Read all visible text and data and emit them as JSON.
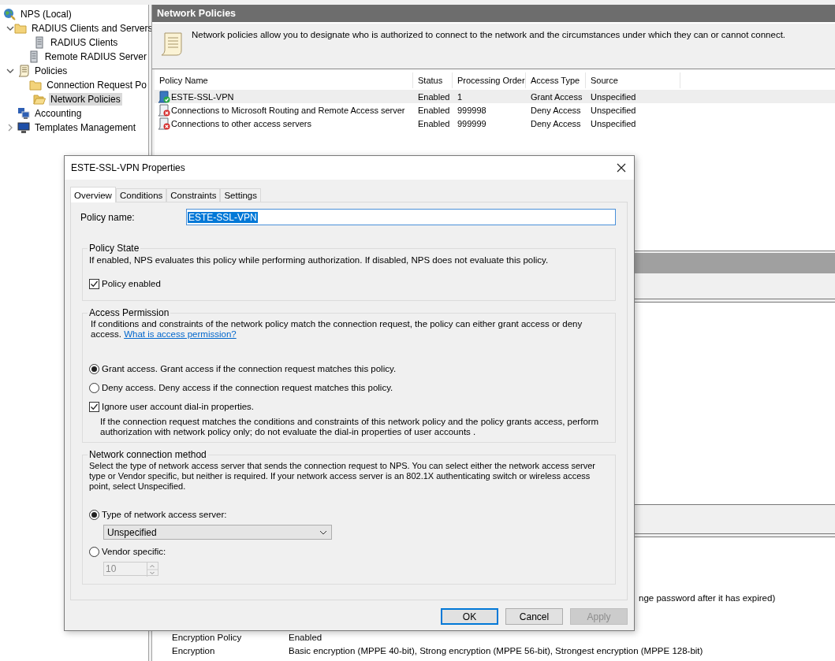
{
  "tree": [
    {
      "label": "NPS (Local)",
      "kind": "globe",
      "selected": false,
      "children": [
        {
          "label": "RADIUS Clients and Servers",
          "kind": "folder",
          "expanded": true,
          "selected": false,
          "children": [
            {
              "label": "RADIUS Clients",
              "kind": "server",
              "selected": false
            },
            {
              "label": "Remote RADIUS Server",
              "kind": "server",
              "selected": false
            }
          ]
        },
        {
          "label": "Policies",
          "kind": "scroll",
          "expanded": true,
          "selected": false,
          "children": [
            {
              "label": "Connection Request Po",
              "kind": "folder",
              "selected": false
            },
            {
              "label": "Network Policies",
              "kind": "folder-open",
              "selected": true
            }
          ]
        },
        {
          "label": "Accounting",
          "kind": "computers",
          "selected": false
        },
        {
          "label": "Templates Management",
          "kind": "monitor",
          "expanded": false,
          "selected": false
        }
      ]
    }
  ],
  "pane_title": "Network Policies",
  "pane_description": "Network policies allow you to designate who is authorized to connect to the network and the circumstances under which they can or cannot connect.",
  "policies": {
    "columns": [
      "Policy Name",
      "Status",
      "Processing Order",
      "Access Type",
      "Source"
    ],
    "rows": [
      {
        "kind": "grant",
        "selected": true,
        "cells": [
          "ESTE-SSL-VPN",
          "Enabled",
          "1",
          "Grant Access",
          "Unspecified"
        ]
      },
      {
        "kind": "deny",
        "selected": false,
        "cells": [
          "Connections to Microsoft Routing and Remote Access server",
          "Enabled",
          "999998",
          "Deny Access",
          "Unspecified"
        ]
      },
      {
        "kind": "deny",
        "selected": false,
        "cells": [
          "Connections to other access servers",
          "Enabled",
          "999999",
          "Deny Access",
          "Unspecified"
        ]
      }
    ]
  },
  "details": [
    {
      "value": "nge password after it has expired)"
    },
    {
      "label": "Encryption Policy",
      "value": "Enabled"
    },
    {
      "label": "Encryption",
      "value": "Basic encryption (MPPE 40-bit), Strong encryption (MPPE 56-bit), Strongest encryption (MPPE 128-bit)"
    }
  ],
  "dialog": {
    "title": "ESTE-SSL-VPN Properties",
    "tabs": [
      {
        "label": "Overview",
        "selected": true
      },
      {
        "label": "Conditions",
        "selected": false
      },
      {
        "label": "Constraints",
        "selected": false
      },
      {
        "label": "Settings",
        "selected": false
      }
    ],
    "policy_name": {
      "label": "Policy name:",
      "value": "ESTE-SSL-VPN",
      "text_selected": true
    },
    "policy_state": {
      "title": "Policy State",
      "description": "If enabled, NPS evaluates this policy while performing authorization. If disabled, NPS does not evaluate this policy.",
      "enabled": {
        "label": "Policy enabled",
        "checked": true
      }
    },
    "access_permission": {
      "title": "Access Permission",
      "description": "If conditions and constraints of the network policy match the connection request, the policy can either grant access or deny access.",
      "link": "What is access permission?",
      "options": [
        {
          "label": "Grant access. Grant access if the connection request matches this policy.",
          "selected": true
        },
        {
          "label": "Deny access. Deny access if the connection request matches this policy.",
          "selected": false
        }
      ],
      "ignore_dialin": {
        "label": "Ignore user account dial-in properties.",
        "checked": true,
        "description": "If the connection request matches the conditions and constraints of this network policy and the policy grants access, perform authorization with network policy only; do not evaluate the dial-in properties of user accounts ."
      }
    },
    "connection_method": {
      "title": "Network connection method",
      "description": "Select the type of network access server that sends the connection request to NPS. You can select either the network access server type or Vendor specific, but neither is required.  If your network access server is an 802.1X authenticating switch or wireless access point, select Unspecified.",
      "server_type": {
        "label": "Type of network access server:",
        "selected": true,
        "value": "Unspecified"
      },
      "vendor": {
        "label": "Vendor specific:",
        "selected": false,
        "value": "10",
        "disabled": true
      }
    },
    "buttons": [
      {
        "label": "OK",
        "default": true,
        "disabled": false
      },
      {
        "label": "Cancel",
        "default": false,
        "disabled": false
      },
      {
        "label": "Apply",
        "default": false,
        "disabled": true
      }
    ]
  }
}
